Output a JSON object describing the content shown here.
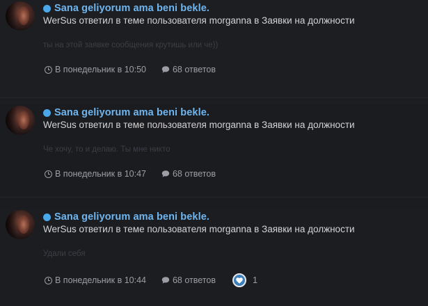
{
  "items": [
    {
      "title": "Sana geliyorum ama beni bekle.",
      "action": "WerSus ответил в теме пользователя morganna в Заявки на должности",
      "snippet": "ты на этой заявке сообщения крутишь или че))",
      "time": "В понедельник в 10:50",
      "replies": "68 ответов"
    },
    {
      "title": "Sana geliyorum ama beni bekle.",
      "action": "WerSus ответил в теме пользователя morganna в Заявки на должности",
      "snippet": "Че хочу, то и делаю. Ты мне никто",
      "time": "В понедельник в 10:47",
      "replies": "68 ответов"
    },
    {
      "title": "Sana geliyorum ama beni bekle.",
      "action": "WerSus ответил в теме пользователя morganna в Заявки на должности",
      "snippet": "Удали себя",
      "time": "В понедельник в 10:44",
      "replies": "68 ответов",
      "likes": "1"
    }
  ],
  "icons": {
    "unread": "unread-dot-icon",
    "time": "clock-icon",
    "replies": "comment-icon",
    "like": "heart-icon"
  },
  "colors": {
    "background": "#1c1d21",
    "title": "#6fb6f0",
    "unread_dot": "#4aa8ea",
    "action_text": "#d4d4d6",
    "snippet_text": "#3c3e45",
    "meta_text": "#9c9ea5",
    "like_badge": "#3d7fb8"
  }
}
